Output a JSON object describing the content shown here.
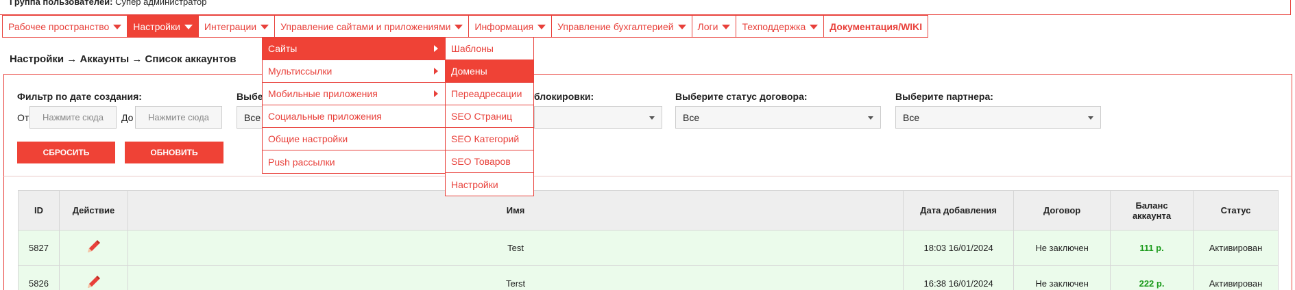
{
  "user_group": {
    "label": "Группа пользователей:",
    "value": "Супер администратор"
  },
  "menu": {
    "items": [
      {
        "label": "Рабочее пространство"
      },
      {
        "label": "Настройки"
      },
      {
        "label": "Интеграции"
      },
      {
        "label": "Управление сайтами и приложениями"
      },
      {
        "label": "Информация"
      },
      {
        "label": "Управление бухгалтерией"
      },
      {
        "label": "Логи"
      },
      {
        "label": "Техподдержка"
      },
      {
        "label": "Документация/WIKI"
      }
    ]
  },
  "submenu": {
    "items": [
      {
        "label": "Сайты"
      },
      {
        "label": "Мультиссылки"
      },
      {
        "label": "Мобильные приложения"
      },
      {
        "label": "Социальные приложения"
      },
      {
        "label": "Общие настройки"
      },
      {
        "label": "Push рассылки"
      }
    ]
  },
  "submenu2": {
    "items": [
      {
        "label": "Шаблоны"
      },
      {
        "label": "Домены"
      },
      {
        "label": "Переадресации"
      },
      {
        "label": "SEO Страниц"
      },
      {
        "label": "SEO Категорий"
      },
      {
        "label": "SEO Товаров"
      },
      {
        "label": "Настройки"
      }
    ]
  },
  "breadcrumb": "Настройки → Аккаунты → Список аккаунтов",
  "filters": {
    "date_label": "Фильтр по дате создания:",
    "from_label": "От",
    "to_label": "До",
    "from_placeholder": "Нажмите сюда",
    "to_placeholder": "Нажмите сюда",
    "second_label_partial": "Выбер",
    "second_value": "Все",
    "block_label_partial": "блокировки:",
    "contract_label": "Выберите статус договора:",
    "contract_value": "Все",
    "partner_label": "Выберите партнера:",
    "partner_value": "Все",
    "reset_button": "СБРОСИТЬ",
    "refresh_button": "ОБНОВИТЬ"
  },
  "table": {
    "headers": {
      "id": "ID",
      "action": "Действие",
      "name": "Имя",
      "date": "Дата добавления",
      "contract": "Договор",
      "balance_1": "Баланс",
      "balance_2": "аккаунта",
      "status": "Статус"
    },
    "rows": [
      {
        "id": "5827",
        "name": "Test",
        "date": "18:03 16/01/2024",
        "contract": "Не заключен",
        "balance": "111 р.",
        "status": "Активирован"
      },
      {
        "id": "5826",
        "name": "Terst",
        "date": "16:38 16/01/2024",
        "contract": "Не заключен",
        "balance": "222 р.",
        "status": "Активирован"
      }
    ]
  },
  "colors": {
    "accent": "#ef4236",
    "border": "#e8403a",
    "row_bg": "#ebfbeb",
    "balance": "#1a9a1a"
  }
}
